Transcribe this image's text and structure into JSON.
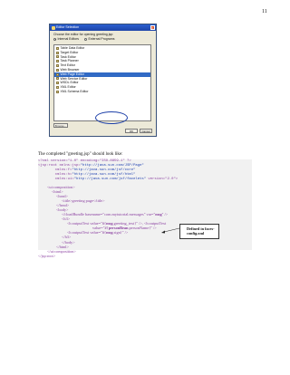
{
  "page_number": "11",
  "dialog": {
    "title": "Editor Selection",
    "close_glyph": "×",
    "prompt": "Choose the editor for opening greeting.jsp:",
    "radios": [
      {
        "label": "Internal Editors",
        "checked": true
      },
      {
        "label": "External Programs",
        "checked": false
      }
    ],
    "editors": [
      {
        "label": "Table Data Editor",
        "selected": false
      },
      {
        "label": "Target Editor",
        "selected": false
      },
      {
        "label": "Task Editor",
        "selected": false
      },
      {
        "label": "Task Planner",
        "selected": false
      },
      {
        "label": "Text Editor",
        "selected": false
      },
      {
        "label": "Web Browser",
        "selected": false
      },
      {
        "label": "Web Page Editor",
        "selected": true
      },
      {
        "label": "Web Service Editor",
        "selected": false
      },
      {
        "label": "WSDL Editor",
        "selected": false
      },
      {
        "label": "XML Editor",
        "selected": false
      },
      {
        "label": "XML Schema Editor",
        "selected": false
      }
    ],
    "browse_label": "Browse...",
    "ok_label": "OK",
    "cancel_label": "Cancel",
    "selection_color": "#316ac5",
    "highlight_color": "#1c3fa8"
  },
  "caption": "The completed \"greeting.jsp\" should look like:",
  "code": {
    "l1": "<?xml version=\"1.0\" encoding=\"ISO-8859-1\" ?>",
    "l2a": "<jsp:root xmlns:jsp=",
    "l2b": "\"http://java.sun.com/JSP/Page\"",
    "l3a": "        xmlns:f=",
    "l3b": "\"http://java.sun.com/jsf/core\"",
    "l4a": "        xmlns:h=",
    "l4b": "\"http://java.sun.com/jsf/html\"",
    "l5a": "        xmlns:ui=",
    "l5b": "\"http://java.sun.com/jsf/facelets\"",
    "l5c": " version=\"2.0\">",
    "l6": "<ui:composition>",
    "l7": "<html>",
    "l8": "<head>",
    "l9": "<title>greeting page</title>",
    "l10": "</head>",
    "l11": "<body>",
    "l12a": "<f:loadBundle basename=\"com.mytutorial.messages\" var=\"",
    "l12b": "msg",
    "l12c": "\" />",
    "l13": "<h3>",
    "l14a": "<h:outputText value=\"#{",
    "l14b": "msg",
    "l14c": ".greeting_text}\" />, <h:outputText",
    "l15a": "value=\"#{",
    "l15b": "personBean",
    "l15c": ".personName}\" />",
    "l16a": "<h:outputText value=\"#{",
    "l16b": "msg",
    "l16c": ".sign}\" />",
    "l17": "</h3>",
    "l18": "</body>",
    "l19": "</html>",
    "l20": "</ui:composition>",
    "l21": "</jsp:root>"
  },
  "note": {
    "line1": "Defined in faces-",
    "line2": "config.xml"
  },
  "colors": {
    "code_background": "#f1f1f1",
    "declaration": "#8a3fa0",
    "string": "#1d3fb0",
    "body_text": "#222222"
  }
}
